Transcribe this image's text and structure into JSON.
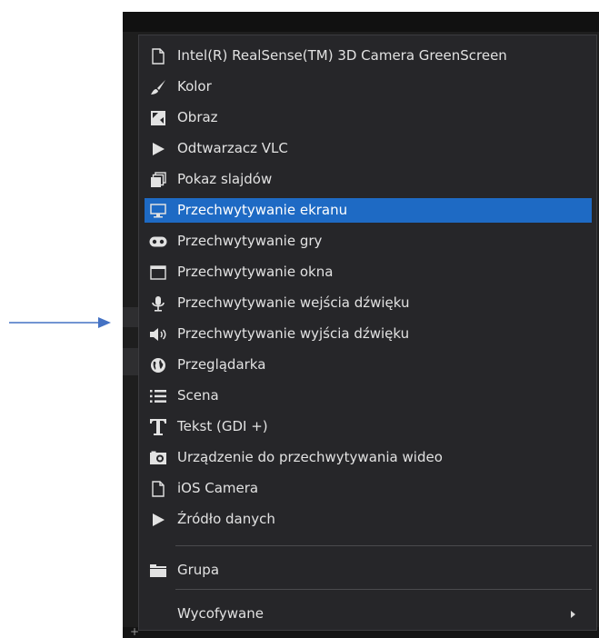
{
  "menu": {
    "items": [
      {
        "label": "Intel(R) RealSense(TM) 3D Camera GreenScreen",
        "icon": "file-icon"
      },
      {
        "label": "Kolor",
        "icon": "paintbrush-icon"
      },
      {
        "label": "Obraz",
        "icon": "image-icon"
      },
      {
        "label": "Odtwarzacz VLC",
        "icon": "play-icon"
      },
      {
        "label": "Pokaz slajdów",
        "icon": "slideshow-icon"
      },
      {
        "label": "Przechwytywanie ekranu",
        "icon": "monitor-icon",
        "selected": true
      },
      {
        "label": "Przechwytywanie gry",
        "icon": "gamepad-icon"
      },
      {
        "label": "Przechwytywanie okna",
        "icon": "window-icon"
      },
      {
        "label": "Przechwytywanie wejścia dźwięku",
        "icon": "microphone-icon"
      },
      {
        "label": "Przechwytywanie wyjścia dźwięku",
        "icon": "speaker-icon"
      },
      {
        "label": "Przeglądarka",
        "icon": "globe-icon"
      },
      {
        "label": "Scena",
        "icon": "list-icon"
      },
      {
        "label": "Tekst (GDI +)",
        "icon": "text-icon"
      },
      {
        "label": "Urządzenie do przechwytywania wideo",
        "icon": "camera-icon"
      },
      {
        "label": "iOS Camera",
        "icon": "file-icon"
      },
      {
        "label": "Źródło danych",
        "icon": "play-icon"
      }
    ],
    "group_label": "Grupa",
    "deprecated_label": "Wycofywane"
  },
  "colors": {
    "menu_bg": "#262629",
    "highlight": "#1e6ac4",
    "text": "#e2e2e2",
    "annotation_arrow": "#4472c4"
  }
}
